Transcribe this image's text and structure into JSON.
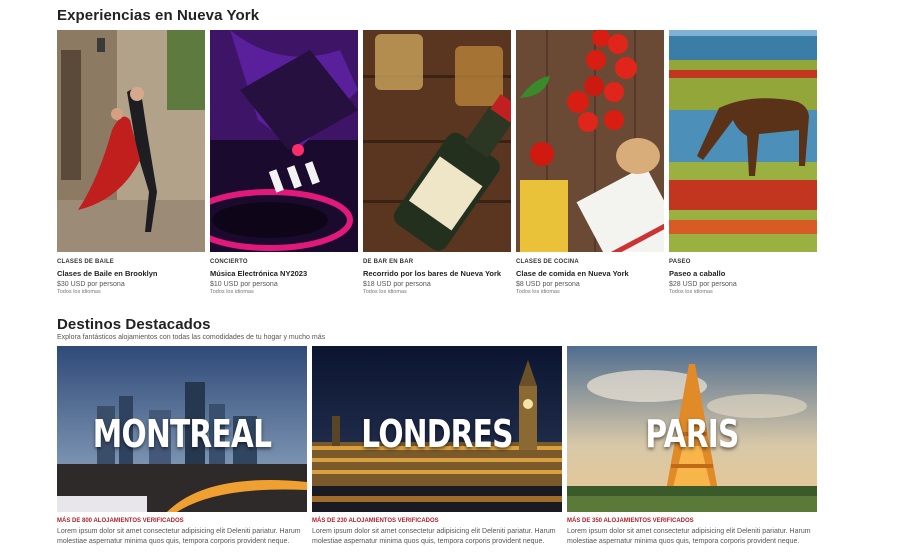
{
  "experiences": {
    "title": "Experiencias en Nueva York",
    "cards": [
      {
        "category": "CLASES DE BAILE",
        "name": "Clases de Baile en Brooklyn",
        "price": "$30 USD por persona",
        "languages": "Todos los idiomas",
        "image": "tango-dancers"
      },
      {
        "category": "CONCIERTO",
        "name": "Música Electrónica NY2023",
        "price": "$10 USD por persona",
        "languages": "Todos los idiomas",
        "image": "dj-turntable"
      },
      {
        "category": "DE BAR EN BAR",
        "name": "Recorrido por los bares de Nueva York",
        "price": "$18 USD por persona",
        "languages": "Todos los idiomas",
        "image": "whisky-bottle"
      },
      {
        "category": "CLASES DE COCINA",
        "name": "Clase de comida en Nueva York",
        "price": "$8 USD por persona",
        "languages": "Todos los idiomas",
        "image": "tomatoes-pasta"
      },
      {
        "category": "PASEO",
        "name": "Paseo a caballo",
        "price": "$28 USD por persona",
        "languages": "Todos los idiomas",
        "image": "horse-meadow"
      }
    ]
  },
  "destinations": {
    "title": "Destinos Destacados",
    "subtitle": "Explora fantásticos alojamientos con todas las comodidades de tu hogar y mucho más",
    "cards": [
      {
        "label": "MONTREAL",
        "count": "MÁS DE 800 ALOJAMIENTOS VERIFICADOS",
        "description": "Lorem ipsum dolor sit amet consectetur adipisicing elit Deleniti pariatur. Harum molestiae aspernatur minima quos quis, tempora corporis provident neque.",
        "image": "montreal-skyline"
      },
      {
        "label": "LONDRES",
        "count": "MÁS DE 230 ALOJAMIENTOS VERIFICADOS",
        "description": "Lorem ipsum dolor sit amet consectetur adipisicing elit Deleniti pariatur. Harum molestiae aspernatur minima quos quis, tempora corporis provident neque.",
        "image": "london-parliament"
      },
      {
        "label": "PARIS",
        "count": "MÁS DE 350 ALOJAMIENTOS VERIFICADOS",
        "description": "Lorem ipsum dolor sit amet consectetur adipisicing elit Deleniti pariatur. Harum molestiae aspernatur minima quos quis, tempora corporis provident neque.",
        "image": "paris-eiffel"
      }
    ]
  }
}
